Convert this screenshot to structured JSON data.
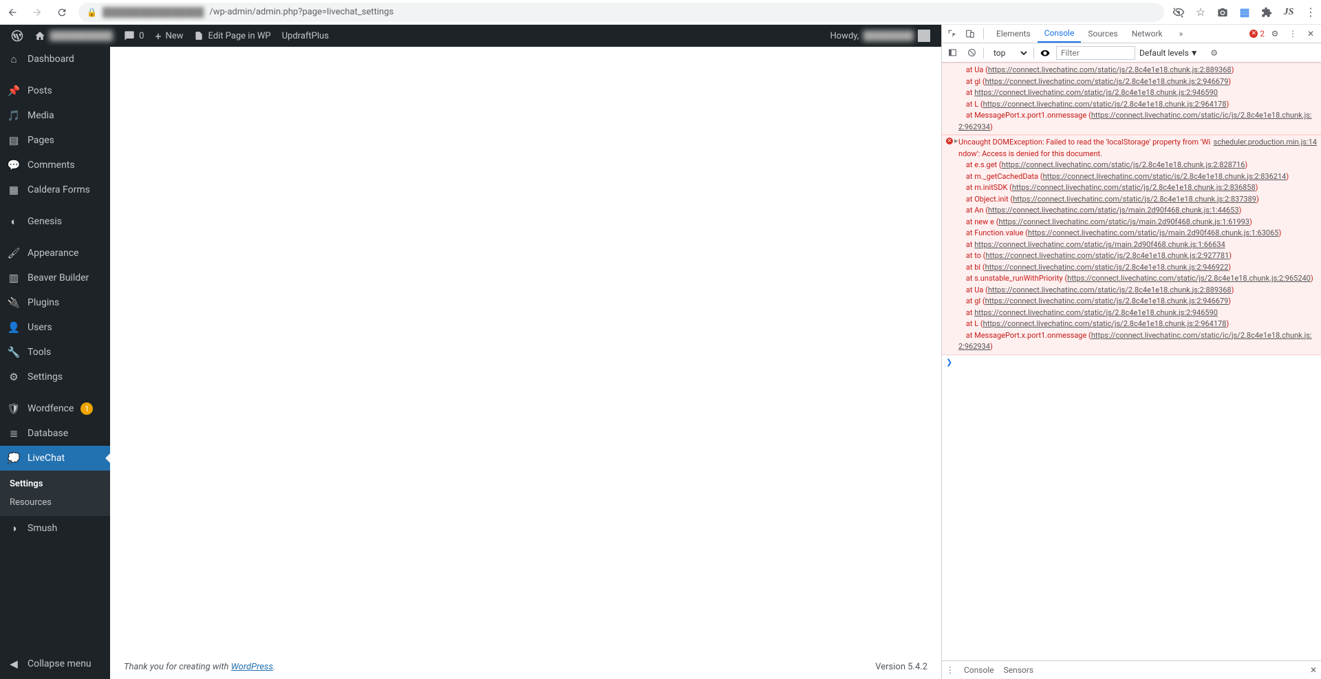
{
  "browser": {
    "url_hidden": "████████████████",
    "url_visible": "/wp-admin/admin.php?page=livechat_settings",
    "ext_js": "JS"
  },
  "wpbar": {
    "site_name": "██████████",
    "comment_count": "0",
    "new_label": "New",
    "edit_label": "Edit Page in WP",
    "updraft": "UpdraftPlus",
    "howdy": "Howdy,",
    "user": "████████"
  },
  "sidebar": {
    "items": [
      {
        "icon": "dashboard",
        "label": "Dashboard"
      },
      {
        "icon": "pin",
        "label": "Posts"
      },
      {
        "icon": "media",
        "label": "Media"
      },
      {
        "icon": "page",
        "label": "Pages"
      },
      {
        "icon": "comment",
        "label": "Comments"
      },
      {
        "icon": "form",
        "label": "Caldera Forms"
      },
      {
        "icon": "genesis",
        "label": "Genesis"
      },
      {
        "icon": "brush",
        "label": "Appearance"
      },
      {
        "icon": "beaver",
        "label": "Beaver Builder"
      },
      {
        "icon": "plugin",
        "label": "Plugins"
      },
      {
        "icon": "user",
        "label": "Users"
      },
      {
        "icon": "wrench",
        "label": "Tools"
      },
      {
        "icon": "settings",
        "label": "Settings"
      },
      {
        "icon": "shield",
        "label": "Wordfence",
        "badge": "1"
      },
      {
        "icon": "database",
        "label": "Database"
      },
      {
        "icon": "livechat",
        "label": "LiveChat",
        "current": true
      },
      {
        "icon": "smush",
        "label": "Smush"
      }
    ],
    "submenu": {
      "settings": "Settings",
      "resources": "Resources"
    },
    "collapse": "Collapse menu"
  },
  "footer": {
    "thanks_prefix": "Thank you for creating with ",
    "wp_link": "WordPress",
    "thanks_suffix": ".",
    "version": "Version 5.4.2"
  },
  "devtools": {
    "tabs": [
      "Elements",
      "Console",
      "Sources",
      "Network"
    ],
    "active_tab": "Console",
    "error_count": "2",
    "context": "top",
    "filter_placeholder": "Filter",
    "levels": "Default levels",
    "drawer": {
      "console": "Console",
      "sensors": "Sensors"
    },
    "errors": {
      "block1": [
        {
          "t": "    at Ua (",
          "u": "https://connect.livechatinc.com/static/js/2.8c4e1e18.chunk.js:2:889368",
          "c": ")"
        },
        {
          "t": "    at gl (",
          "u": "https://connect.livechatinc.com/static/js/2.8c4e1e18.chunk.js:2:946679",
          "c": ")"
        },
        {
          "t": "    at ",
          "u": "https://connect.livechatinc.com/static/js/2.8c4e1e18.chunk.js:2:946590",
          "c": ""
        },
        {
          "t": "    at L (",
          "u": "https://connect.livechatinc.com/static/js/2.8c4e1e18.chunk.js:2:964178",
          "c": ")"
        },
        {
          "t": "    at MessagePort.x.port1.onmessage (",
          "u": "https://connect.livechatinc.com/static/ic/js/2.8c4e1e18.chunk.js:2:962934",
          "c": ")"
        }
      ],
      "block2": {
        "source": "scheduler.production.min.js:14",
        "head": "Uncaught DOMException: Failed to read the 'localStorage' property from 'Window': Access is denied for this document.",
        "stack": [
          {
            "t": "    at e.s.get (",
            "u": "https://connect.livechatinc.com/static/js/2.8c4e1e18.chunk.js:2:828716",
            "c": ")"
          },
          {
            "t": "    at m._getCachedData (",
            "u": "https://connect.livechatinc.com/static/js/2.8c4e1e18.chunk.js:2:836214",
            "c": ")"
          },
          {
            "t": "    at m.initSDK (",
            "u": "https://connect.livechatinc.com/static/js/2.8c4e1e18.chunk.js:2:836858",
            "c": ")"
          },
          {
            "t": "    at Object.init (",
            "u": "https://connect.livechatinc.com/static/js/2.8c4e1e18.chunk.js:2:837389",
            "c": ")"
          },
          {
            "t": "    at An (",
            "u": "https://connect.livechatinc.com/static/js/main.2d90f468.chunk.js:1:44653",
            "c": ")"
          },
          {
            "t": "    at new e (",
            "u": "https://connect.livechatinc.com/static/js/main.2d90f468.chunk.js:1:61993",
            "c": ")"
          },
          {
            "t": "    at Function.value (",
            "u": "https://connect.livechatinc.com/static/js/main.2d90f468.chunk.js:1:63065",
            "c": ")"
          },
          {
            "t": "    at ",
            "u": "https://connect.livechatinc.com/static/js/main.2d90f468.chunk.js:1:66634",
            "c": ""
          },
          {
            "t": "    at to (",
            "u": "https://connect.livechatinc.com/static/js/2.8c4e1e18.chunk.js:2:927781",
            "c": ")"
          },
          {
            "t": "    at bl (",
            "u": "https://connect.livechatinc.com/static/js/2.8c4e1e18.chunk.js:2:946922",
            "c": ")"
          },
          {
            "t": "    at s.unstable_runWithPriority (",
            "u": "https://connect.livechatinc.com/static/js/2.8c4e1e18.chunk.js:2:965240",
            "c": ")"
          },
          {
            "t": "    at Ua (",
            "u": "https://connect.livechatinc.com/static/js/2.8c4e1e18.chunk.js:2:889368",
            "c": ")"
          },
          {
            "t": "    at gl (",
            "u": "https://connect.livechatinc.com/static/js/2.8c4e1e18.chunk.js:2:946679",
            "c": ")"
          },
          {
            "t": "    at ",
            "u": "https://connect.livechatinc.com/static/js/2.8c4e1e18.chunk.js:2:946590",
            "c": ""
          },
          {
            "t": "    at L (",
            "u": "https://connect.livechatinc.com/static/js/2.8c4e1e18.chunk.js:2:964178",
            "c": ")"
          },
          {
            "t": "    at MessagePort.x.port1.onmessage (",
            "u": "https://connect.livechatinc.com/static/ic/js/2.8c4e1e18.chunk.js:2:962934",
            "c": ")"
          }
        ]
      }
    }
  }
}
